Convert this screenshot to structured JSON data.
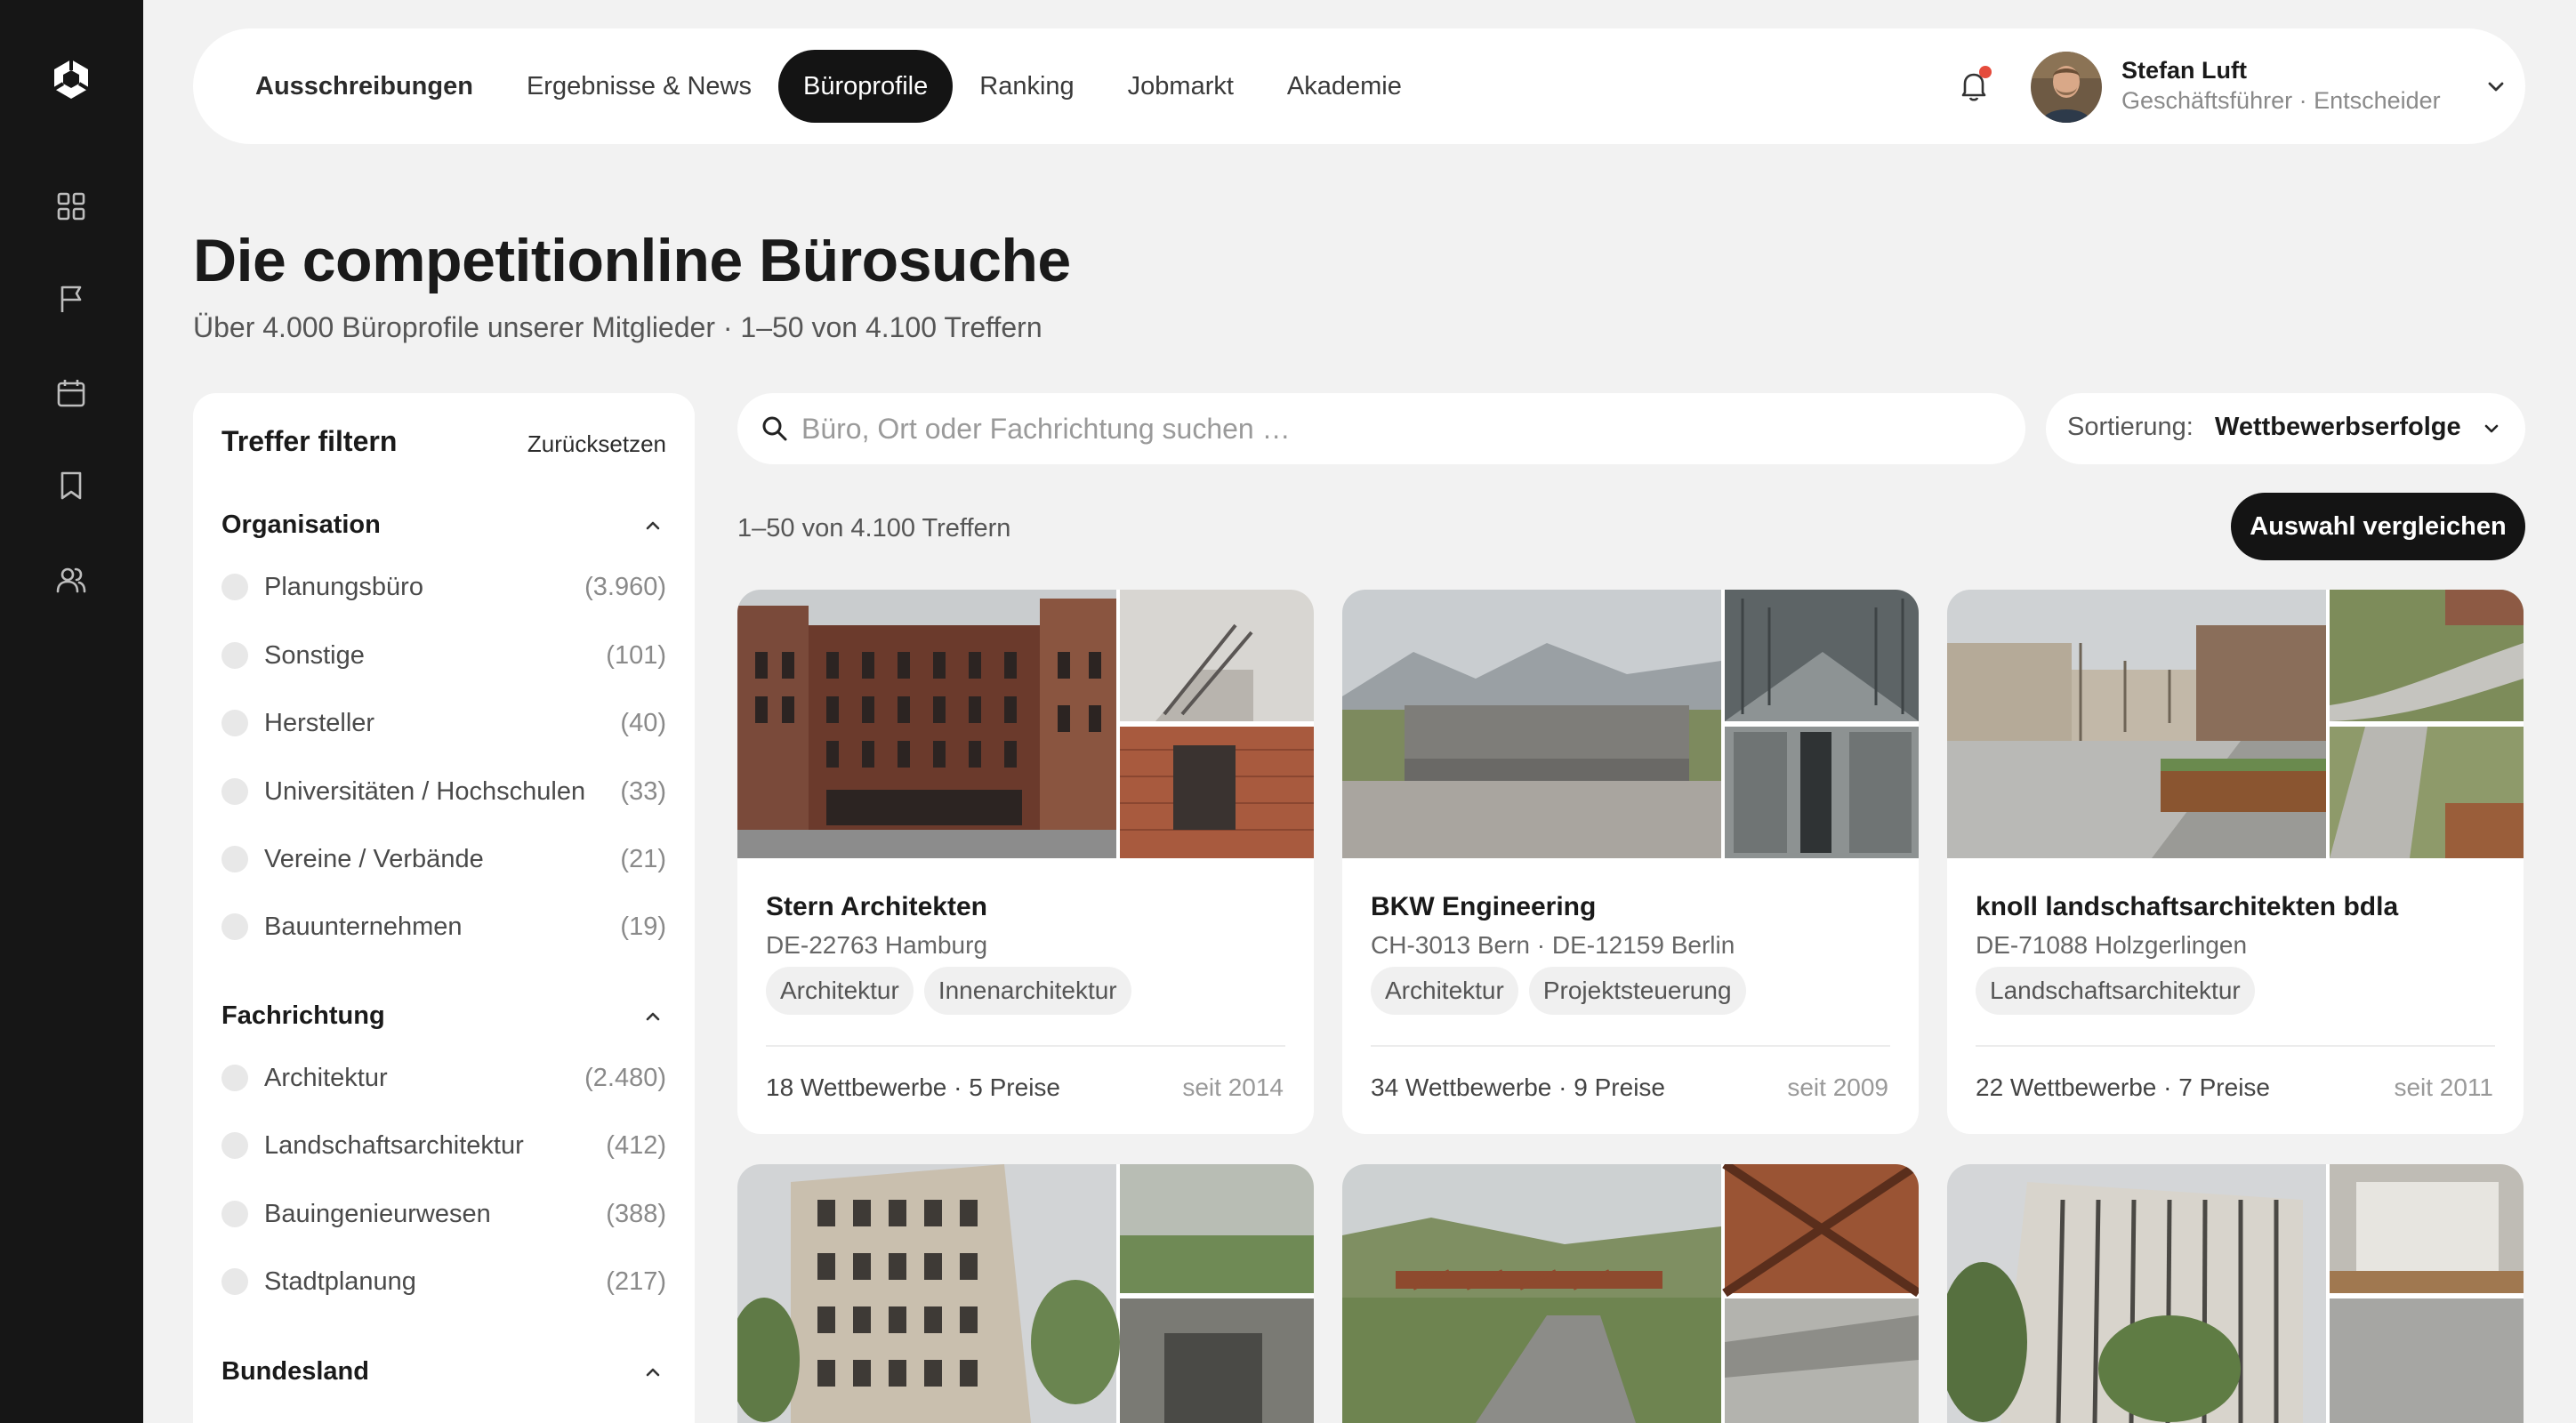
{
  "nav": {
    "items": [
      {
        "label": "Ausschreibungen"
      },
      {
        "label": "Ergebnisse & News"
      },
      {
        "label": "Büroprofile"
      },
      {
        "label": "Ranking"
      },
      {
        "label": "Jobmarkt"
      },
      {
        "label": "Akademie"
      }
    ],
    "active_index": 2
  },
  "user": {
    "name": "Stefan Luft",
    "role": "Geschäftsführer · Entscheider"
  },
  "page": {
    "title": "Die competitionline Bürosuche",
    "subtitle": "Über 4.000 Büroprofile unserer Mitglieder · 1–50 von 4.100 Treffern"
  },
  "filter": {
    "title": "Treffer filtern",
    "reset": "Zurücksetzen",
    "groups": [
      {
        "title": "Organisation",
        "options": [
          {
            "label": "Planungsbüro",
            "count": "(3.960)"
          },
          {
            "label": "Sonstige",
            "count": "(101)"
          },
          {
            "label": "Hersteller",
            "count": "(40)"
          },
          {
            "label": "Universitäten / Hochschulen",
            "count": "(33)"
          },
          {
            "label": "Vereine / Verbände",
            "count": "(21)"
          },
          {
            "label": "Bauunternehmen",
            "count": "(19)"
          }
        ]
      },
      {
        "title": "Fachrichtung",
        "options": [
          {
            "label": "Architektur",
            "count": "(2.480)"
          },
          {
            "label": "Landschaftsarchitektur",
            "count": "(412)"
          },
          {
            "label": "Bauingenieurwesen",
            "count": "(388)"
          },
          {
            "label": "Stadtplanung",
            "count": "(217)"
          }
        ]
      },
      {
        "title": "Bundesland",
        "options": []
      }
    ]
  },
  "search": {
    "placeholder": "Büro, Ort oder Fachrichtung suchen …",
    "value": ""
  },
  "sort": {
    "label": "Sortierung:",
    "value": "Wettbewerbserfolge"
  },
  "results": {
    "count_text": "1–50 von 4.100 Treffern",
    "compare_label": "Auswahl vergleichen"
  },
  "cards": [
    {
      "name": "Stern Architekten",
      "location": "DE-22763 Hamburg",
      "tags": [
        "Architektur",
        "Innenarchitektur"
      ],
      "stats": "18 Wettbewerbe · 5 Preise",
      "since": "seit 2014"
    },
    {
      "name": "BKW Engineering",
      "location": "CH-3013 Bern · DE-12159 Berlin",
      "tags": [
        "Architektur",
        "Projektsteuerung"
      ],
      "stats": "34 Wettbewerbe · 9 Preise",
      "since": "seit 2009"
    },
    {
      "name": "knoll landschaftsarchitekten bdla",
      "location": "DE-71088 Holzgerlingen",
      "tags": [
        "Landschaftsarchitektur"
      ],
      "stats": "22 Wettbewerbe · 7 Preise",
      "since": "seit 2011"
    }
  ],
  "colors": {
    "rail": "#161616",
    "background": "#f2f2f2",
    "accent": "#141414",
    "notification": "#e54b3c"
  }
}
